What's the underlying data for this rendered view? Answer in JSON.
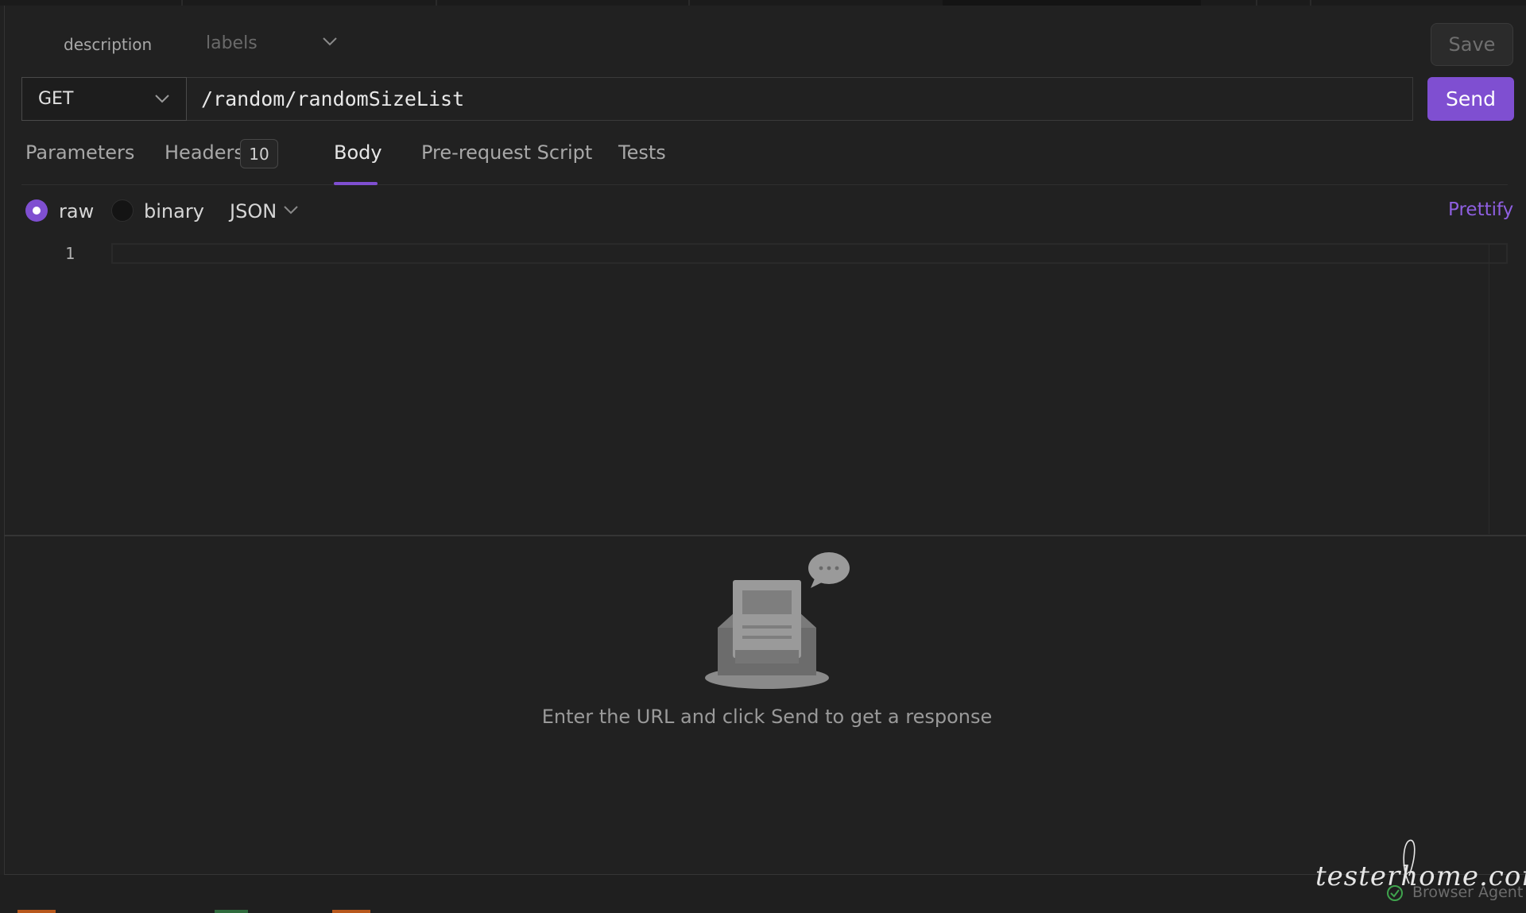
{
  "request": {
    "description_label": "description",
    "labels_placeholder": "labels",
    "save_label": "Save",
    "method": "GET",
    "url": "/random/randomSizeList",
    "send_label": "Send"
  },
  "tabs": [
    {
      "label": "Parameters"
    },
    {
      "label": "Headers",
      "badge": "10"
    },
    {
      "label": "Body",
      "active": true
    },
    {
      "label": "Pre-request Script"
    },
    {
      "label": "Tests"
    }
  ],
  "body": {
    "mode_options": [
      "raw",
      "binary"
    ],
    "selected_mode": "raw",
    "format": "JSON",
    "prettify_label": "Prettify",
    "line_number": "1"
  },
  "response": {
    "empty_message": "Enter the URL and click Send to get a response"
  },
  "status_bar": {
    "agent_label": "Browser Agent"
  },
  "watermark": {
    "text": "testerhome.com"
  },
  "colors": {
    "accent": "#7f4fd1",
    "background": "#212121",
    "prettify": "#8e5fe0"
  },
  "icons": [
    "chevron-down-icon",
    "inbox-empty-icon",
    "chat-bubble-icon",
    "check-circle-icon"
  ]
}
